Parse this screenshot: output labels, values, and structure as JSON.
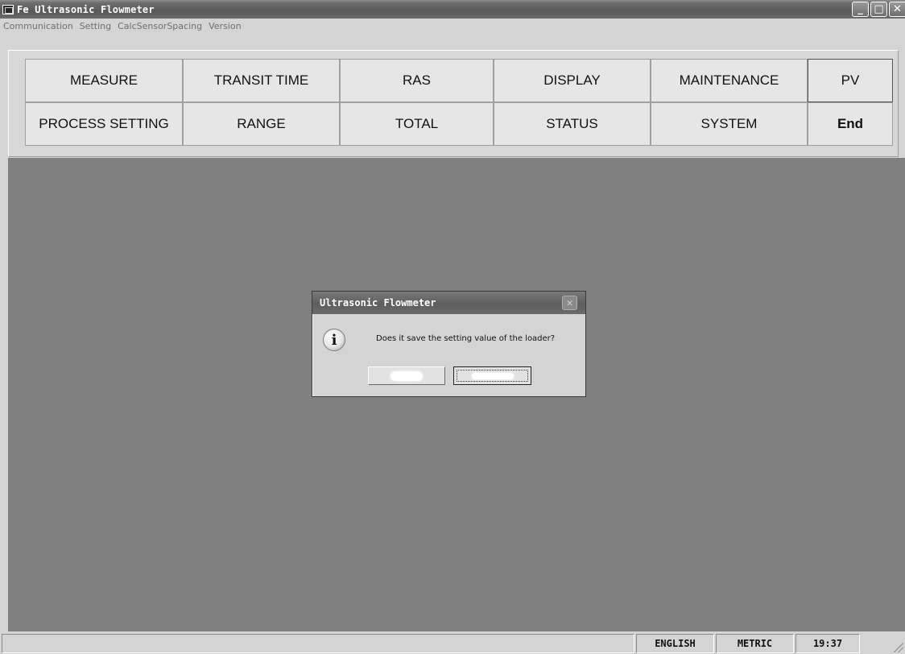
{
  "window": {
    "title": "Fe Ultrasonic Flowmeter",
    "controls": {
      "minimize": "_",
      "maximize": "□",
      "close": "✕"
    }
  },
  "menu": {
    "items": [
      "Communication",
      "Setting",
      "CalcSensorSpacing",
      "Version"
    ]
  },
  "toolbar": {
    "row1": [
      "MEASURE",
      "TRANSIT TIME",
      "RAS",
      "DISPLAY",
      "MAINTENANCE",
      "PV"
    ],
    "row2": [
      "PROCESS SETTING",
      "RANGE",
      "TOTAL",
      "STATUS",
      "SYSTEM",
      "End"
    ]
  },
  "dialog": {
    "title": "Ultrasonic Flowmeter",
    "close_glyph": "✕",
    "icon": "information-icon",
    "icon_glyph": "i",
    "message": "Does it save the setting value of the loader?"
  },
  "statusbar": {
    "language": "ENGLISH",
    "units": "METRIC",
    "time": "19:37"
  }
}
